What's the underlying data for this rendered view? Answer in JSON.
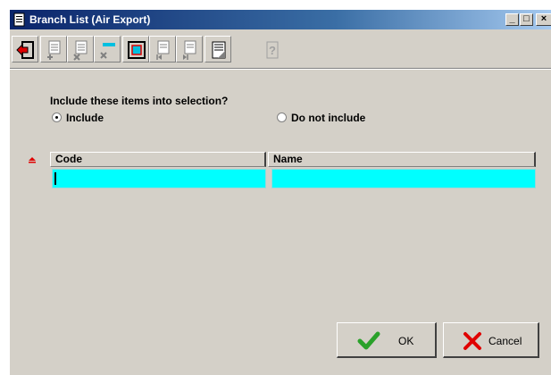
{
  "window": {
    "title": "Branch List (Air Export)",
    "icon": "document-icon",
    "controls": {
      "minimize": "_",
      "restore": "□",
      "close": "×"
    }
  },
  "toolbar": {
    "buttons": [
      {
        "name": "exit",
        "icon": "exit-door-icon",
        "enabled": true
      },
      {
        "name": "add-record",
        "icon": "document-plus-icon",
        "enabled": false
      },
      {
        "name": "delete-record",
        "icon": "document-x-icon",
        "enabled": false
      },
      {
        "name": "clear-field",
        "icon": "line-x-icon",
        "enabled": false
      },
      {
        "name": "select",
        "icon": "frame-select-icon",
        "enabled": true
      },
      {
        "name": "first-record",
        "icon": "document-first-icon",
        "enabled": false
      },
      {
        "name": "last-record",
        "icon": "document-last-icon",
        "enabled": false
      },
      {
        "name": "page",
        "icon": "page-curl-icon",
        "enabled": true
      },
      {
        "name": "help",
        "icon": "question-page-icon",
        "enabled": false
      }
    ]
  },
  "selection": {
    "prompt": "Include these items into selection?",
    "options": [
      {
        "label": "Include",
        "checked": true
      },
      {
        "label": "Do not include",
        "checked": false
      }
    ]
  },
  "grid": {
    "sort_indicator": "sort-ascending-icon",
    "columns": [
      {
        "label": "Code"
      },
      {
        "label": "Name"
      }
    ],
    "rows": [
      {
        "code": "",
        "name": ""
      }
    ],
    "active_row_color": "#00ffff"
  },
  "actions": {
    "ok": {
      "label": "OK",
      "icon": "checkmark-icon"
    },
    "cancel": {
      "label": "Cancel",
      "icon": "x-mark-icon"
    }
  },
  "colors": {
    "titlebar_start": "#0a246a",
    "titlebar_end": "#a6caf0",
    "face": "#d4d0c8",
    "accent_cyan": "#00ffff"
  }
}
